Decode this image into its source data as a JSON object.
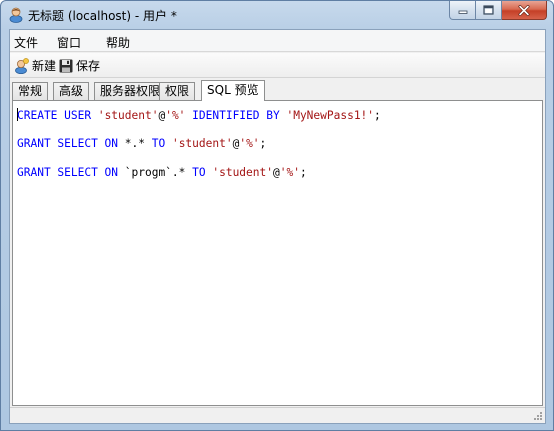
{
  "window": {
    "title": "无标题 (localhost) - 用户 *"
  },
  "menubar": {
    "items": [
      "文件",
      "窗口",
      "帮助"
    ]
  },
  "toolbar": {
    "new_label": "新建",
    "save_label": "保存"
  },
  "tabs": [
    {
      "label": "常规",
      "active": false
    },
    {
      "label": "高级",
      "active": false
    },
    {
      "label": "服务器权限",
      "active": false
    },
    {
      "label": "权限",
      "active": false
    },
    {
      "label": "SQL 预览",
      "active": true
    }
  ],
  "sql_preview": {
    "lines": [
      [
        {
          "t": "CREATE USER ",
          "c": "kw"
        },
        {
          "t": "'student'",
          "c": "str"
        },
        {
          "t": "@",
          "c": "plain"
        },
        {
          "t": "'%'",
          "c": "str"
        },
        {
          "t": " IDENTIFIED BY ",
          "c": "kw"
        },
        {
          "t": "'MyNewPass1!'",
          "c": "str"
        },
        {
          "t": ";",
          "c": "plain"
        }
      ],
      [
        {
          "t": "GRANT SELECT ON ",
          "c": "kw"
        },
        {
          "t": "*.* ",
          "c": "plain"
        },
        {
          "t": "TO ",
          "c": "kw"
        },
        {
          "t": "'student'",
          "c": "str"
        },
        {
          "t": "@",
          "c": "plain"
        },
        {
          "t": "'%'",
          "c": "str"
        },
        {
          "t": ";",
          "c": "plain"
        }
      ],
      [
        {
          "t": "GRANT SELECT ON ",
          "c": "kw"
        },
        {
          "t": "`progm`.* ",
          "c": "plain"
        },
        {
          "t": "TO ",
          "c": "kw"
        },
        {
          "t": "'student'",
          "c": "str"
        },
        {
          "t": "@",
          "c": "plain"
        },
        {
          "t": "'%'",
          "c": "str"
        },
        {
          "t": ";",
          "c": "plain"
        }
      ]
    ]
  },
  "colors": {
    "keyword": "#0000ff",
    "string": "#a31515"
  },
  "icons": {
    "app": "user-icon",
    "new": "new-user-icon",
    "save": "floppy-disk-icon",
    "minimize": "minimize-icon",
    "maximize": "maximize-icon",
    "close": "close-icon"
  }
}
